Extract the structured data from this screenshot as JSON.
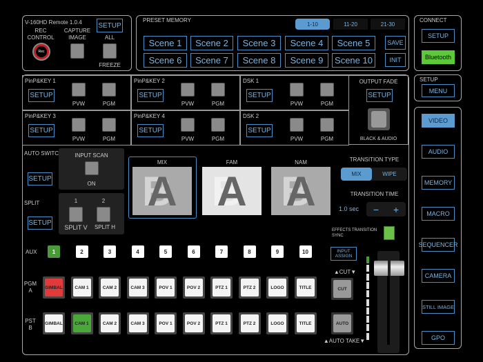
{
  "header": {
    "app_title": "V-160HD Remote 1.0.4",
    "setup": "SETUP",
    "rec_control": "REC CONTROL",
    "rec": "Rec",
    "capture_image": "CAPTURE IMAGE",
    "all": "ALL",
    "freeze": "FREEZE"
  },
  "preset": {
    "title": "PRESET MEMORY",
    "tabs": [
      "1-10",
      "11-20",
      "21-30"
    ],
    "active_tab": "1-10",
    "scenes": [
      "Scene 1",
      "Scene 2",
      "Scene 3",
      "Scene 4",
      "Scene 5",
      "Scene 6",
      "Scene 7",
      "Scene 8",
      "Scene 9",
      "Scene 10"
    ],
    "save": "SAVE",
    "init": "INIT"
  },
  "connect": {
    "title": "CONNECT",
    "setup": "SETUP",
    "bluetooth": "Bluetooth"
  },
  "setup_menu": {
    "title": "SETUP",
    "menu": "MENU"
  },
  "nav": {
    "items": [
      "VIDEO",
      "AUDIO",
      "MEMORY",
      "MACRO",
      "SEQUENCER",
      "CAMERA",
      "STILL IMAGE",
      "GPO"
    ],
    "active": "VIDEO"
  },
  "keys": [
    {
      "name": "PinP&KEY 1"
    },
    {
      "name": "PinP&KEY 2"
    },
    {
      "name": "DSK 1"
    },
    {
      "name": "PinP&KEY 3"
    },
    {
      "name": "PinP&KEY 4"
    },
    {
      "name": "DSK 2"
    }
  ],
  "key_labels": {
    "setup": "SETUP",
    "pvw": "PVW",
    "pgm": "PGM"
  },
  "output_fade": {
    "title": "OUTPUT FADE",
    "setup": "SETUP",
    "label": "BLACK & AUDIO"
  },
  "auto_switching": {
    "title": "AUTO SWITCHING",
    "setup": "SETUP",
    "input_scan": "INPUT SCAN",
    "on": "ON"
  },
  "split": {
    "title": "SPLIT",
    "setup": "SETUP",
    "n1": "1",
    "n2": "2",
    "v": "SPLIT V",
    "h": "SPLIT H"
  },
  "transitions": {
    "thumbs": [
      "MIX",
      "FAM",
      "NAM"
    ],
    "type_title": "TRANSITION TYPE",
    "types": [
      "MIX",
      "WIPE"
    ],
    "active_type": "MIX",
    "time_title": "TRANSITION TIME",
    "time": "1.0 sec",
    "minus": "−",
    "plus": "+",
    "sync": "EFFECTS TRANSITION SYNC"
  },
  "aux": {
    "label": "AUX",
    "buttons": [
      "1",
      "2",
      "3",
      "4",
      "5",
      "6",
      "7",
      "8",
      "9",
      "10"
    ],
    "active": "1",
    "input_assign": "INPUT ASSIGN"
  },
  "pgm": {
    "label": "PGM A",
    "sources": [
      "GIMBAL",
      "CAM 1",
      "CAM 2",
      "CAM 3",
      "POV 1",
      "POV 2",
      "PTZ 1",
      "PTZ 2",
      "LOGO",
      "TITLE"
    ],
    "active": "GIMBAL"
  },
  "pst": {
    "label": "PST B",
    "sources": [
      "GIMBAL",
      "CAM 1",
      "CAM 2",
      "CAM 3",
      "POV 1",
      "POV 2",
      "PTZ 1",
      "PTZ 2",
      "LOGO",
      "TITLE"
    ],
    "active": "CAM 1"
  },
  "cut": {
    "title": "▲CUT▼",
    "label": "CUT"
  },
  "auto": {
    "title": "▲AUTO TAKE▼",
    "label": "AUTO"
  },
  "fader": {
    "position": 0
  }
}
